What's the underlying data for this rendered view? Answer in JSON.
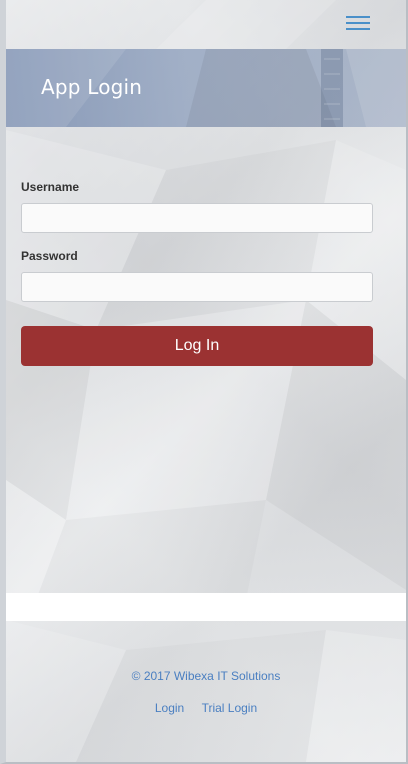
{
  "header": {
    "menu_icon": "hamburger-menu-icon"
  },
  "banner": {
    "title": "App Login"
  },
  "form": {
    "username_label": "Username",
    "username_value": "",
    "password_label": "Password",
    "password_value": "",
    "login_button": "Log In"
  },
  "footer": {
    "copyright": "© 2017 Wibexa IT Solutions",
    "links": [
      "Login",
      "Trial Login"
    ]
  },
  "colors": {
    "accent_button": "#9b3232",
    "link": "#4a7fc1",
    "menu_icon": "#4a90c9"
  }
}
